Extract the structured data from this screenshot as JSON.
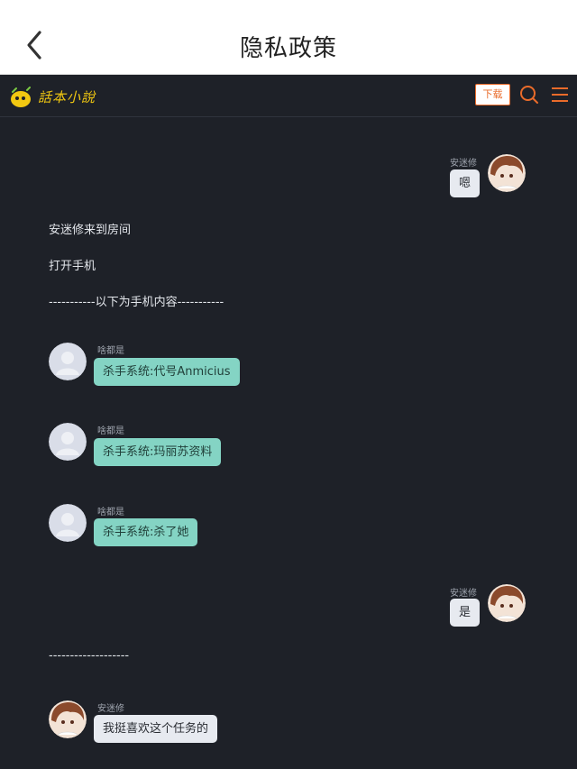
{
  "header": {
    "title": "隐私政策"
  },
  "site": {
    "logo_text": "話本小說",
    "download_label": "下载"
  },
  "icons": {
    "back": "chevron-left-icon",
    "search": "search-icon",
    "menu": "hamburger-menu-icon"
  },
  "colors": {
    "brand_yellow": "#f2c811",
    "download_orange": "#e96b2a",
    "system_bubble": "#84d4c4",
    "background": "#1e2128"
  },
  "messages": [
    {
      "sender": "安迷修",
      "text": "嗯"
    },
    {
      "sender": "啥都是",
      "text": "杀手系统:代号Anmicius"
    },
    {
      "sender": "啥都是",
      "text": "杀手系统:玛丽苏资料"
    },
    {
      "sender": "啥都是",
      "text": "杀手系统:杀了她"
    },
    {
      "sender": "安迷修",
      "text": "是"
    },
    {
      "sender": "安迷修",
      "text": "我挺喜欢这个任务的"
    }
  ],
  "narration": [
    "安迷修来到房间",
    "打开手机",
    "-----------以下为手机内容-----------",
    "-------------------"
  ]
}
